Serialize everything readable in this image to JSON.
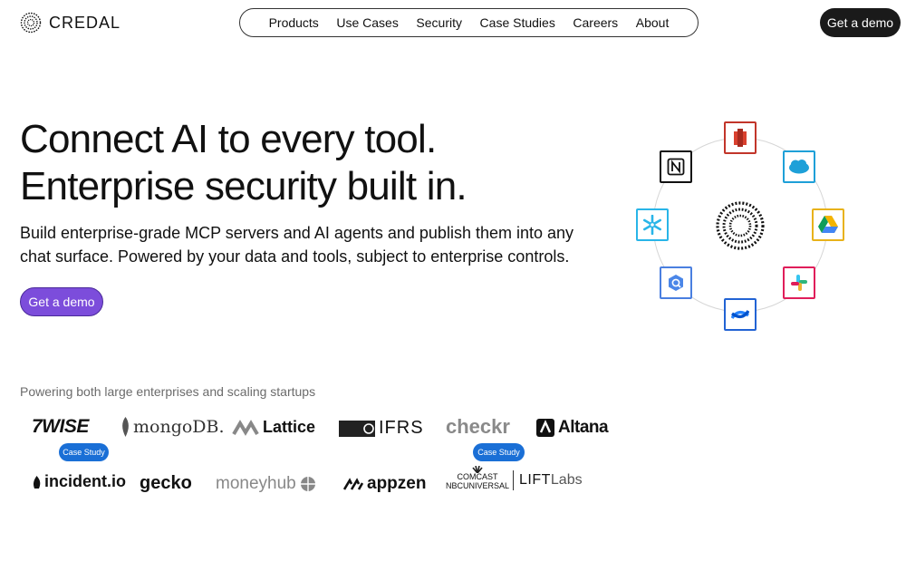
{
  "header": {
    "logo_text": "CREDAL",
    "nav": [
      "Products",
      "Use Cases",
      "Security",
      "Case Studies",
      "Careers",
      "About"
    ],
    "cta": "Get a demo"
  },
  "hero": {
    "headline_line1": "Connect AI to every tool.",
    "headline_line2": "Enterprise security built in.",
    "subhead_line1": "Build enterprise-grade MCP servers and AI agents and publish them into any",
    "subhead_line2": "chat surface. Powered by your data and tools, subject to enterprise controls.",
    "cta": "Get a demo",
    "cta_color": "#7c4ddb"
  },
  "customers": {
    "heading": "Powering both large enterprises and scaling startups",
    "logos": [
      "7WISE",
      "mongoDB.",
      "Lattice",
      "IFRS",
      "checkr",
      "Altana",
      "incident.io",
      "gecko",
      "moneyhub",
      "appzen",
      "COMCAST",
      "NBCUNIVERSAL",
      "LIFT",
      "Labs"
    ],
    "badge": "Case Study",
    "badge_color": "#1a6fd6"
  },
  "integrations": {
    "icons": [
      "aws-icon",
      "salesforce-icon",
      "google-drive-icon",
      "slack-icon",
      "confluence-icon",
      "bigquery-icon",
      "snowflake-icon",
      "notion-icon"
    ]
  }
}
